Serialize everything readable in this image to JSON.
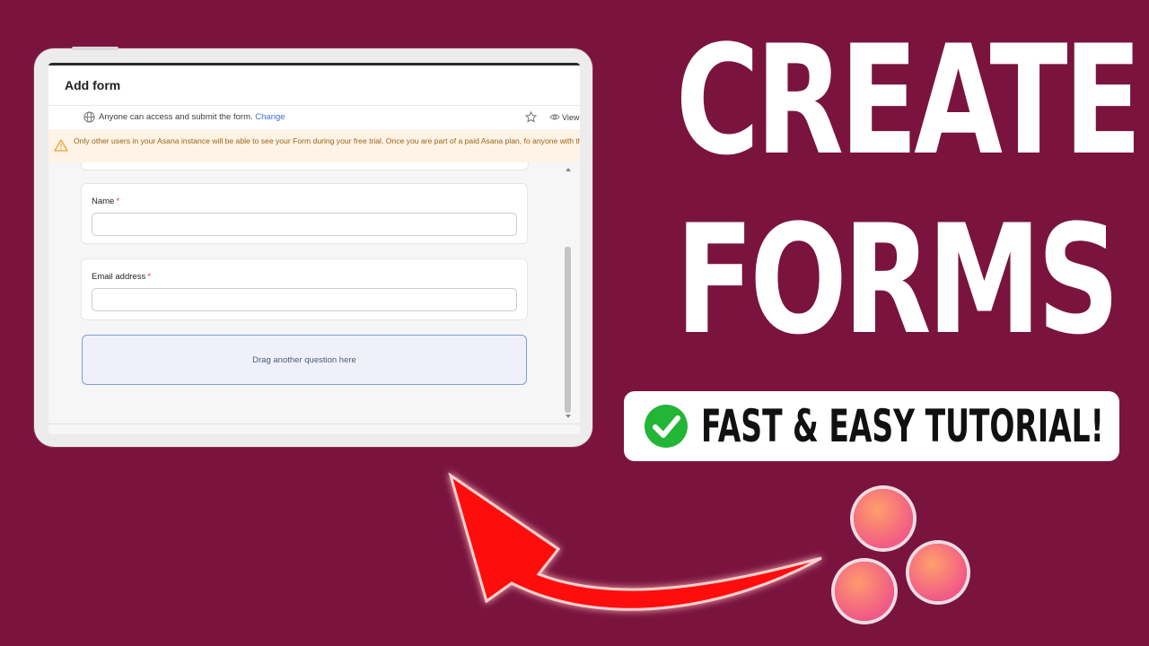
{
  "form_panel": {
    "title": "Add form",
    "access_text": "Anyone can access and submit the form.",
    "access_link": "Change",
    "view_label": "View",
    "banner_text": "Only other users in your Asana instance will be able to see your Form during your free trial. Once you are part of a paid Asana plan, fo anyone with the form URL.",
    "fields": [
      {
        "label": "Name",
        "required_mark": "*"
      },
      {
        "label": "Email address",
        "required_mark": "*"
      }
    ],
    "drop_zone_text": "Drag another question here"
  },
  "headline": {
    "line1": "CREATE",
    "line2": "FORMS"
  },
  "badge": {
    "text": "FAST & EASY TUTORIAL!"
  },
  "colors": {
    "background": "#7a143e",
    "arrow": "#ff0a0a",
    "check": "#22b536",
    "link": "#3a6fd1",
    "banner": "#fdf3e6"
  },
  "icons": [
    "globe-icon",
    "star-icon",
    "eye-icon",
    "warning-icon",
    "check-circle-icon",
    "arrow-graphic",
    "asana-logo"
  ]
}
